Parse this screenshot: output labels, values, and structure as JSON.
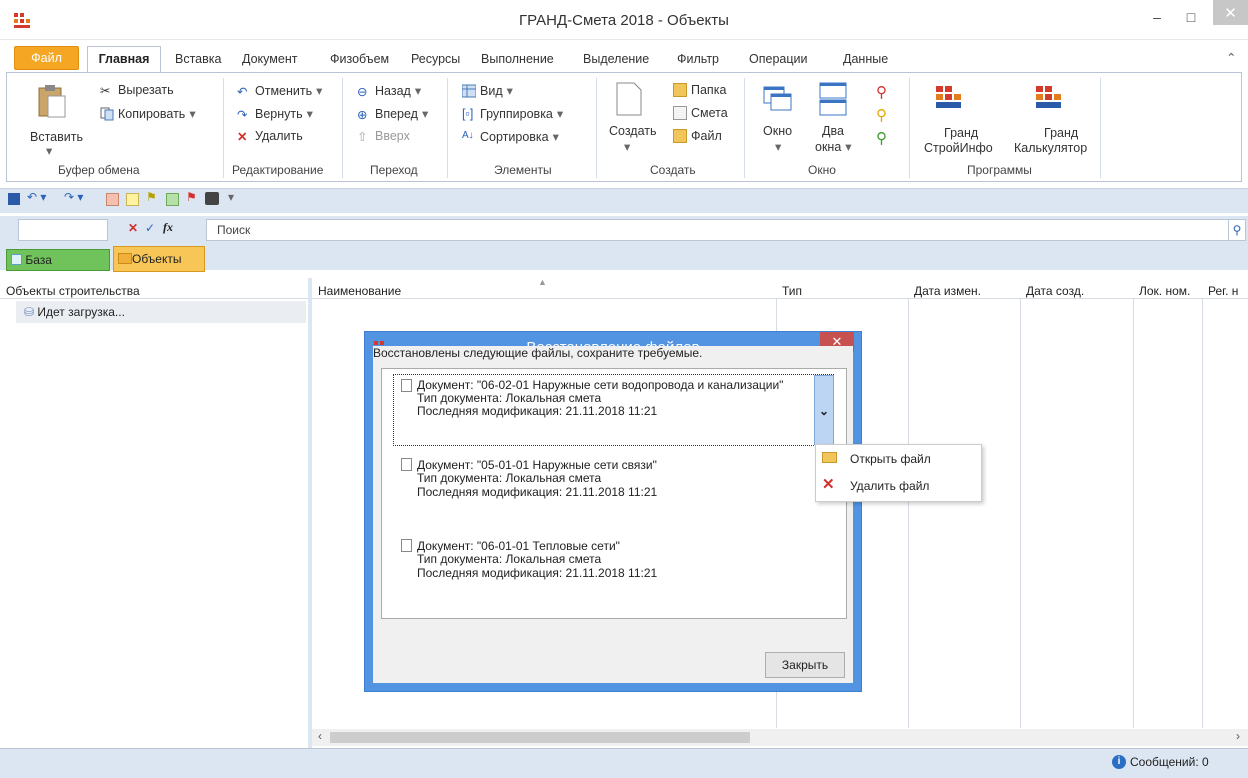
{
  "window": {
    "title": "ГРАНД-Смета 2018 - Объекты",
    "minimize": "–",
    "maximize": "□",
    "close": "✕"
  },
  "tabs": {
    "file": "Файл",
    "active": "Главная",
    "items": [
      "Вставка",
      "Документ",
      "Физобъем",
      "Ресурсы",
      "Выполнение",
      "Выделение",
      "Фильтр",
      "Операции",
      "Данные"
    ],
    "collapse": "⌃"
  },
  "ribbon": {
    "clipboard": {
      "paste": "Вставить",
      "cut": "Вырезать",
      "copy": "Копировать",
      "label": "Буфер обмена"
    },
    "edit": {
      "undo": "Отменить",
      "redo": "Вернуть",
      "delete": "Удалить",
      "label": "Редактирование"
    },
    "nav": {
      "back": "Назад",
      "forward": "Вперед",
      "up": "Вверх",
      "label": "Переход"
    },
    "elements": {
      "view": "Вид",
      "grouping": "Группировка",
      "sort": "Сортировка",
      "label": "Элементы"
    },
    "create": {
      "create": "Создать",
      "folder": "Папка",
      "estimate": "Смета",
      "file": "Файл",
      "label": "Создать"
    },
    "window": {
      "window": "Окно",
      "two": "Два",
      "two2": "окна",
      "label": "Окно"
    },
    "programs": {
      "p1a": "Гранд",
      "p1b": "СтройИнфо",
      "p2a": "Гранд",
      "p2b": "Калькулятор",
      "label": "Программы"
    }
  },
  "formula": {
    "search_placeholder": "Поиск",
    "fx": "fx"
  },
  "doc_tabs": {
    "base": "База",
    "objects": "Объекты"
  },
  "left_panel": {
    "header": "Объекты строительства",
    "loading": "Идет загрузка..."
  },
  "columns": {
    "name": "Наименование",
    "type": "Тип",
    "modified": "Дата измен.",
    "created": "Дата созд.",
    "local_num": "Лок. ном.",
    "reg_num": "Рег. н"
  },
  "dialog": {
    "title": "Восстановление файлов",
    "message": "Восстановлены следующие файлы, сохраните требуемые.",
    "close_button": "Закрыть",
    "files": [
      {
        "doc": "Документ: \"06-02-01 Наружные сети водопровода и канализации\"",
        "type": "Тип документа: Локальная смета",
        "mod": "Последняя модификация: 21.11.2018 11:21"
      },
      {
        "doc": "Документ: \"05-01-01 Наружные сети связи\"",
        "type": "Тип документа: Локальная смета",
        "mod": "Последняя модификация: 21.11.2018 11:21"
      },
      {
        "doc": "Документ: \"06-01-01 Тепловые сети\"",
        "type": "Тип документа: Локальная смета",
        "mod": "Последняя модификация: 21.11.2018 11:21"
      }
    ]
  },
  "context_menu": {
    "open": "Открыть файл",
    "delete": "Удалить файл"
  },
  "status": {
    "messages": "Сообщений: 0"
  }
}
